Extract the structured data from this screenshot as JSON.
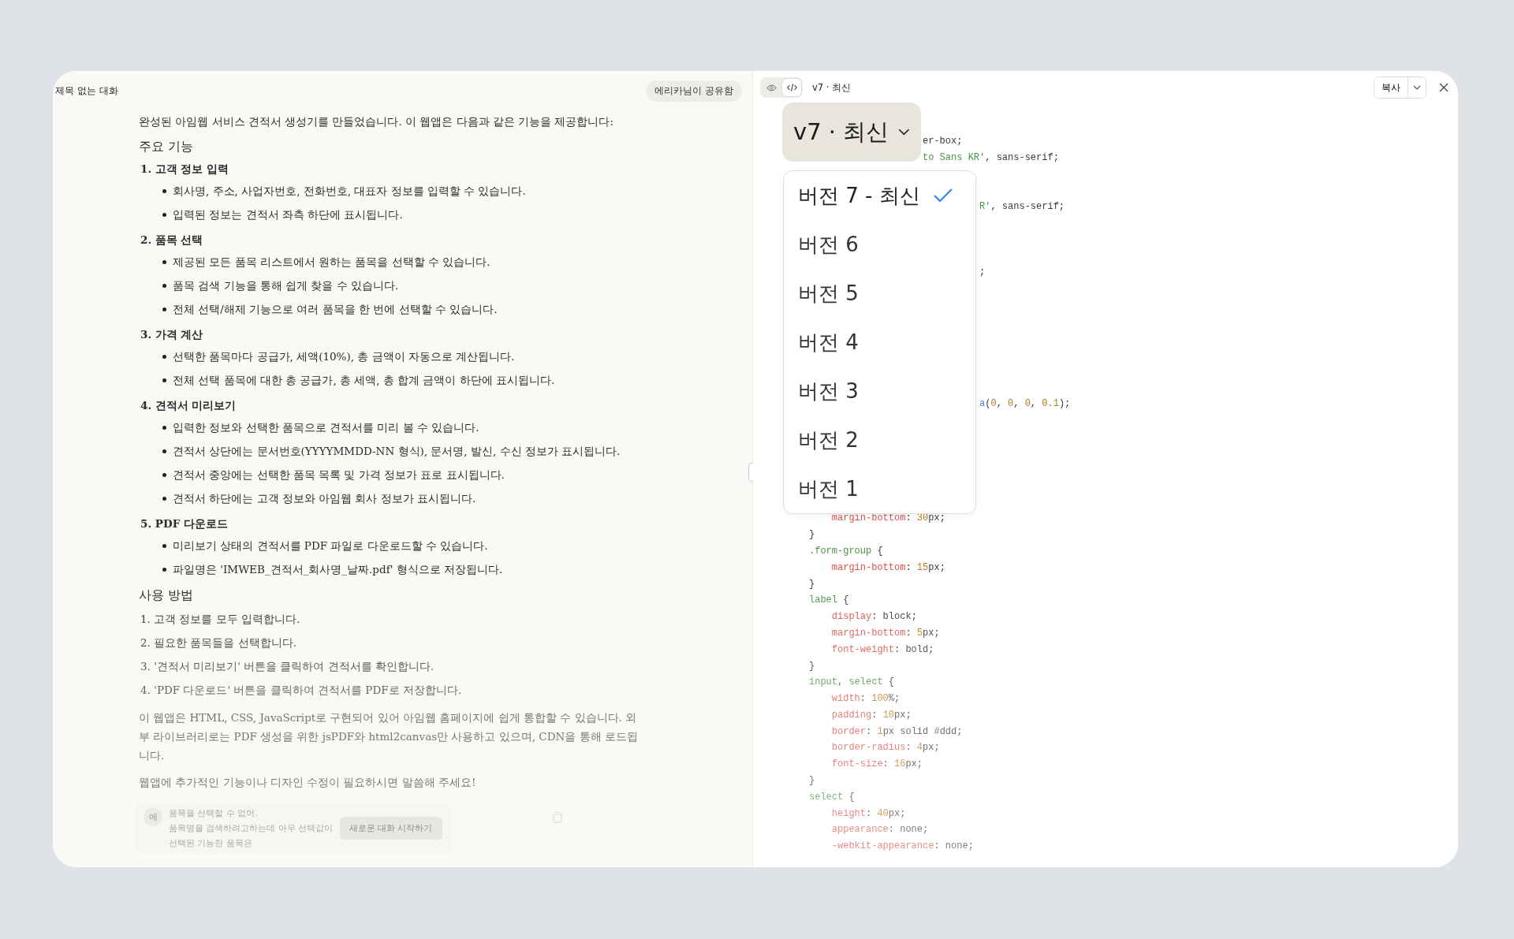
{
  "conversation": {
    "title": "제목 없는 대화",
    "share_chip": "에리카님이 공유함",
    "blocks": [
      {
        "kind": "para",
        "text": "완성된 아임웹 서비스 견적서 생성기를 만들었습니다. 이 웹앱은 다음과 같은 기능을 제공합니다:"
      },
      {
        "kind": "heading",
        "text": "주요 기능"
      },
      {
        "kind": "section",
        "title": "1. 고객 정보 입력",
        "bullets": [
          "회사명, 주소, 사업자번호, 전화번호, 대표자 정보를 입력할 수 있습니다.",
          "입력된 정보는 견적서 좌측 하단에 표시됩니다."
        ]
      },
      {
        "kind": "section",
        "title": "2. 품목 선택",
        "bullets": [
          "제공된 모든 품목 리스트에서 원하는 품목을 선택할 수 있습니다.",
          "품목 검색 기능을 통해 쉽게 찾을 수 있습니다.",
          "전체 선택/해제 기능으로 여러 품목을 한 번에 선택할 수 있습니다."
        ]
      },
      {
        "kind": "section",
        "title": "3. 가격 계산",
        "bullets": [
          "선택한 품목마다 공급가, 세액(10%), 총 금액이 자동으로 계산됩니다.",
          "전체 선택 품목에 대한 총 공급가, 총 세액, 총 합계 금액이 하단에 표시됩니다."
        ]
      },
      {
        "kind": "section",
        "title": "4. 견적서 미리보기",
        "bullets": [
          "입력한 정보와 선택한 품목으로 견적서를 미리 볼 수 있습니다.",
          "견적서 상단에는 문서번호(YYYYMMDD-NN 형식), 문서명, 발신, 수신 정보가 표시됩니다.",
          "견적서 중앙에는 선택한 품목 목록 및 가격 정보가 표로 표시됩니다.",
          "견적서 하단에는 고객 정보와 아임웹 회사 정보가 표시됩니다."
        ]
      },
      {
        "kind": "section",
        "title": "5. PDF 다운로드",
        "bullets": [
          "미리보기 상태의 견적서를 PDF 파일로 다운로드할 수 있습니다.",
          "파일명은 'IMWEB_견적서_회사명_날짜.pdf' 형식으로 저장됩니다."
        ]
      },
      {
        "kind": "heading",
        "text": "사용 방법"
      },
      {
        "kind": "step",
        "text": "1. 고객 정보를 모두 입력합니다."
      },
      {
        "kind": "step",
        "text": "2. 필요한 품목들을 선택합니다."
      },
      {
        "kind": "step",
        "text": "3. '견적서 미리보기' 버튼을 클릭하여 견적서를 확인합니다."
      },
      {
        "kind": "step",
        "text": "4. 'PDF 다운로드' 버튼을 클릭하여 견적서를 PDF로 저장합니다."
      },
      {
        "kind": "para",
        "text": "이 웹앱은 HTML, CSS, JavaScript로 구현되어 있어 아임웹 홈페이지에 쉽게 통합할 수 있습니다. 외부 라이브러리로는 PDF 생성을 위한 jsPDF와 html2canvas만 사용하고 있으며, CDN을 통해 로드됩니다."
      },
      {
        "kind": "para",
        "text": "웹앱에 추가적인 기능이나 디자인 수정이 필요하시면 말씀해 주세요!"
      }
    ],
    "prompt_card": {
      "avatar": "에",
      "lines": [
        "품목을 선택할 수 없어.",
        "품목명을 검색하려고하는데 아무 선택값이",
        "선택된 기능한 품목은"
      ],
      "button": "새로운 대화 시작하기"
    }
  },
  "artifact": {
    "view_tabs": [
      {
        "kind": "preview",
        "selected": false
      },
      {
        "kind": "code",
        "selected": true
      }
    ],
    "version_label": "v7 · 최신",
    "copy_button": "복사",
    "version_button": "v7 · 최신",
    "version_menu": [
      {
        "label": "버전 7 - 최신",
        "selected": true
      },
      {
        "label": "버전 6",
        "selected": false
      },
      {
        "label": "버전 5",
        "selected": false
      },
      {
        "label": "버전 4",
        "selected": false
      },
      {
        "label": "버전 3",
        "selected": false
      },
      {
        "label": "버전 2",
        "selected": false
      },
      {
        "label": "버전 1",
        "selected": false
      }
    ],
    "code": [
      {
        "kind": "under_button",
        "segments": [
          {
            "kind": "plain",
            "text": "er-box;"
          }
        ]
      },
      {
        "kind": "under_button",
        "segments": [
          {
            "kind": "str",
            "text": "to Sans KR'"
          },
          {
            "kind": "plain",
            "text": ", sans-serif;"
          }
        ]
      },
      {
        "kind": "covered"
      },
      {
        "kind": "covered"
      },
      {
        "kind": "under_menu",
        "segments": [
          {
            "kind": "str",
            "text": "R'"
          },
          {
            "kind": "plain",
            "text": ", sans-serif;"
          }
        ]
      },
      {
        "kind": "covered"
      },
      {
        "kind": "covered"
      },
      {
        "kind": "covered"
      },
      {
        "kind": "under_menu",
        "segments": [
          {
            "kind": "plain",
            "text": ";"
          }
        ]
      },
      {
        "kind": "covered"
      },
      {
        "kind": "covered"
      },
      {
        "kind": "covered"
      },
      {
        "kind": "covered"
      },
      {
        "kind": "covered"
      },
      {
        "kind": "covered"
      },
      {
        "kind": "covered"
      },
      {
        "kind": "under_menu",
        "segments": [
          {
            "kind": "fn",
            "text": "a"
          },
          {
            "kind": "plain",
            "text": "("
          },
          {
            "kind": "num",
            "text": "0"
          },
          {
            "kind": "plain",
            "text": ", "
          },
          {
            "kind": "num",
            "text": "0"
          },
          {
            "kind": "plain",
            "text": ", "
          },
          {
            "kind": "num",
            "text": "0"
          },
          {
            "kind": "plain",
            "text": ", "
          },
          {
            "kind": "num",
            "text": "0.1"
          },
          {
            "kind": "plain",
            "text": ");"
          }
        ]
      },
      {
        "kind": "covered"
      },
      {
        "kind": "covered"
      },
      {
        "kind": "covered"
      },
      {
        "kind": "covered"
      },
      {
        "kind": "covered"
      },
      {
        "kind": "covered"
      },
      {
        "kind": "decl",
        "segments": [
          {
            "kind": "prop",
            "text": "margin-bottom"
          },
          {
            "kind": "plain",
            "text": ": "
          },
          {
            "kind": "num",
            "text": "30"
          },
          {
            "kind": "plain",
            "text": "px;"
          }
        ]
      },
      {
        "kind": "rule",
        "segments": [
          {
            "kind": "plain",
            "text": "}"
          }
        ]
      },
      {
        "kind": "rule",
        "segments": [
          {
            "kind": "sel",
            "text": ".form-group"
          },
          {
            "kind": "plain",
            "text": " {"
          }
        ]
      },
      {
        "kind": "decl",
        "segments": [
          {
            "kind": "prop",
            "text": "margin-bottom"
          },
          {
            "kind": "plain",
            "text": ": "
          },
          {
            "kind": "num",
            "text": "15"
          },
          {
            "kind": "plain",
            "text": "px;"
          }
        ]
      },
      {
        "kind": "rule",
        "segments": [
          {
            "kind": "plain",
            "text": "}"
          }
        ]
      },
      {
        "kind": "rule",
        "segments": [
          {
            "kind": "sel",
            "text": "label"
          },
          {
            "kind": "plain",
            "text": " {"
          }
        ]
      },
      {
        "kind": "decl",
        "segments": [
          {
            "kind": "prop",
            "text": "display"
          },
          {
            "kind": "plain",
            "text": ": block;"
          }
        ]
      },
      {
        "kind": "decl",
        "segments": [
          {
            "kind": "prop",
            "text": "margin-bottom"
          },
          {
            "kind": "plain",
            "text": ": "
          },
          {
            "kind": "num",
            "text": "5"
          },
          {
            "kind": "plain",
            "text": "px;"
          }
        ]
      },
      {
        "kind": "decl",
        "segments": [
          {
            "kind": "prop",
            "text": "font-weight"
          },
          {
            "kind": "plain",
            "text": ": bold;"
          }
        ]
      },
      {
        "kind": "rule",
        "segments": [
          {
            "kind": "plain",
            "text": "}"
          }
        ]
      },
      {
        "kind": "rule",
        "segments": [
          {
            "kind": "sel",
            "text": "input"
          },
          {
            "kind": "plain",
            "text": ", "
          },
          {
            "kind": "sel",
            "text": "select"
          },
          {
            "kind": "plain",
            "text": " {"
          }
        ]
      },
      {
        "kind": "decl",
        "segments": [
          {
            "kind": "prop",
            "text": "width"
          },
          {
            "kind": "plain",
            "text": ": "
          },
          {
            "kind": "num",
            "text": "100"
          },
          {
            "kind": "plain",
            "text": "%;"
          }
        ]
      },
      {
        "kind": "decl",
        "segments": [
          {
            "kind": "prop",
            "text": "padding"
          },
          {
            "kind": "plain",
            "text": ": "
          },
          {
            "kind": "num",
            "text": "10"
          },
          {
            "kind": "plain",
            "text": "px;"
          }
        ]
      },
      {
        "kind": "decl",
        "segments": [
          {
            "kind": "prop",
            "text": "border"
          },
          {
            "kind": "plain",
            "text": ": "
          },
          {
            "kind": "num",
            "text": "1"
          },
          {
            "kind": "plain",
            "text": "px solid #ddd;"
          }
        ]
      },
      {
        "kind": "decl",
        "segments": [
          {
            "kind": "prop",
            "text": "border-radius"
          },
          {
            "kind": "plain",
            "text": ": "
          },
          {
            "kind": "num",
            "text": "4"
          },
          {
            "kind": "plain",
            "text": "px;"
          }
        ]
      },
      {
        "kind": "decl",
        "segments": [
          {
            "kind": "prop",
            "text": "font-size"
          },
          {
            "kind": "plain",
            "text": ": "
          },
          {
            "kind": "num",
            "text": "16"
          },
          {
            "kind": "plain",
            "text": "px;"
          }
        ]
      },
      {
        "kind": "rule",
        "segments": [
          {
            "kind": "plain",
            "text": "}"
          }
        ]
      },
      {
        "kind": "rule",
        "segments": [
          {
            "kind": "sel",
            "text": "select"
          },
          {
            "kind": "plain",
            "text": " {"
          }
        ]
      },
      {
        "kind": "decl",
        "segments": [
          {
            "kind": "prop",
            "text": "height"
          },
          {
            "kind": "plain",
            "text": ": "
          },
          {
            "kind": "num",
            "text": "40"
          },
          {
            "kind": "plain",
            "text": "px;"
          }
        ]
      },
      {
        "kind": "decl",
        "segments": [
          {
            "kind": "prop",
            "text": "appearance"
          },
          {
            "kind": "plain",
            "text": ": none;"
          }
        ]
      },
      {
        "kind": "decl",
        "segments": [
          {
            "kind": "prop",
            "text": "-webkit-appearance"
          },
          {
            "kind": "plain",
            "text": ": none;"
          }
        ]
      }
    ]
  }
}
